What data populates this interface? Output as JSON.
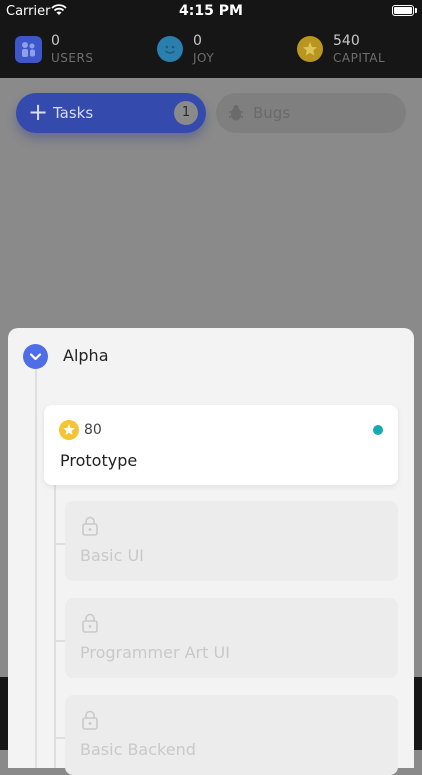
{
  "status_bar": {
    "carrier": "Carrier",
    "time": "4:15 PM"
  },
  "stats": [
    {
      "value": "0",
      "label": "USERS",
      "icon": "users-icon"
    },
    {
      "value": "0",
      "label": "JOY",
      "icon": "smiley-icon"
    },
    {
      "value": "540",
      "label": "CAPITAL",
      "icon": "star-coin-icon"
    }
  ],
  "tabs": {
    "tasks": {
      "label": "Tasks",
      "count": "1"
    },
    "bugs": {
      "label": "Bugs"
    }
  },
  "sheet": {
    "title": "Alpha",
    "cards": [
      {
        "score": "80",
        "name": "Prototype",
        "status_color": "#13aab2"
      },
      {
        "name": "Basic UI"
      },
      {
        "name": "Programmer Art UI"
      },
      {
        "name": "Basic Backend"
      }
    ]
  },
  "colors": {
    "accent": "#4f6de6",
    "star": "#f4c531"
  }
}
